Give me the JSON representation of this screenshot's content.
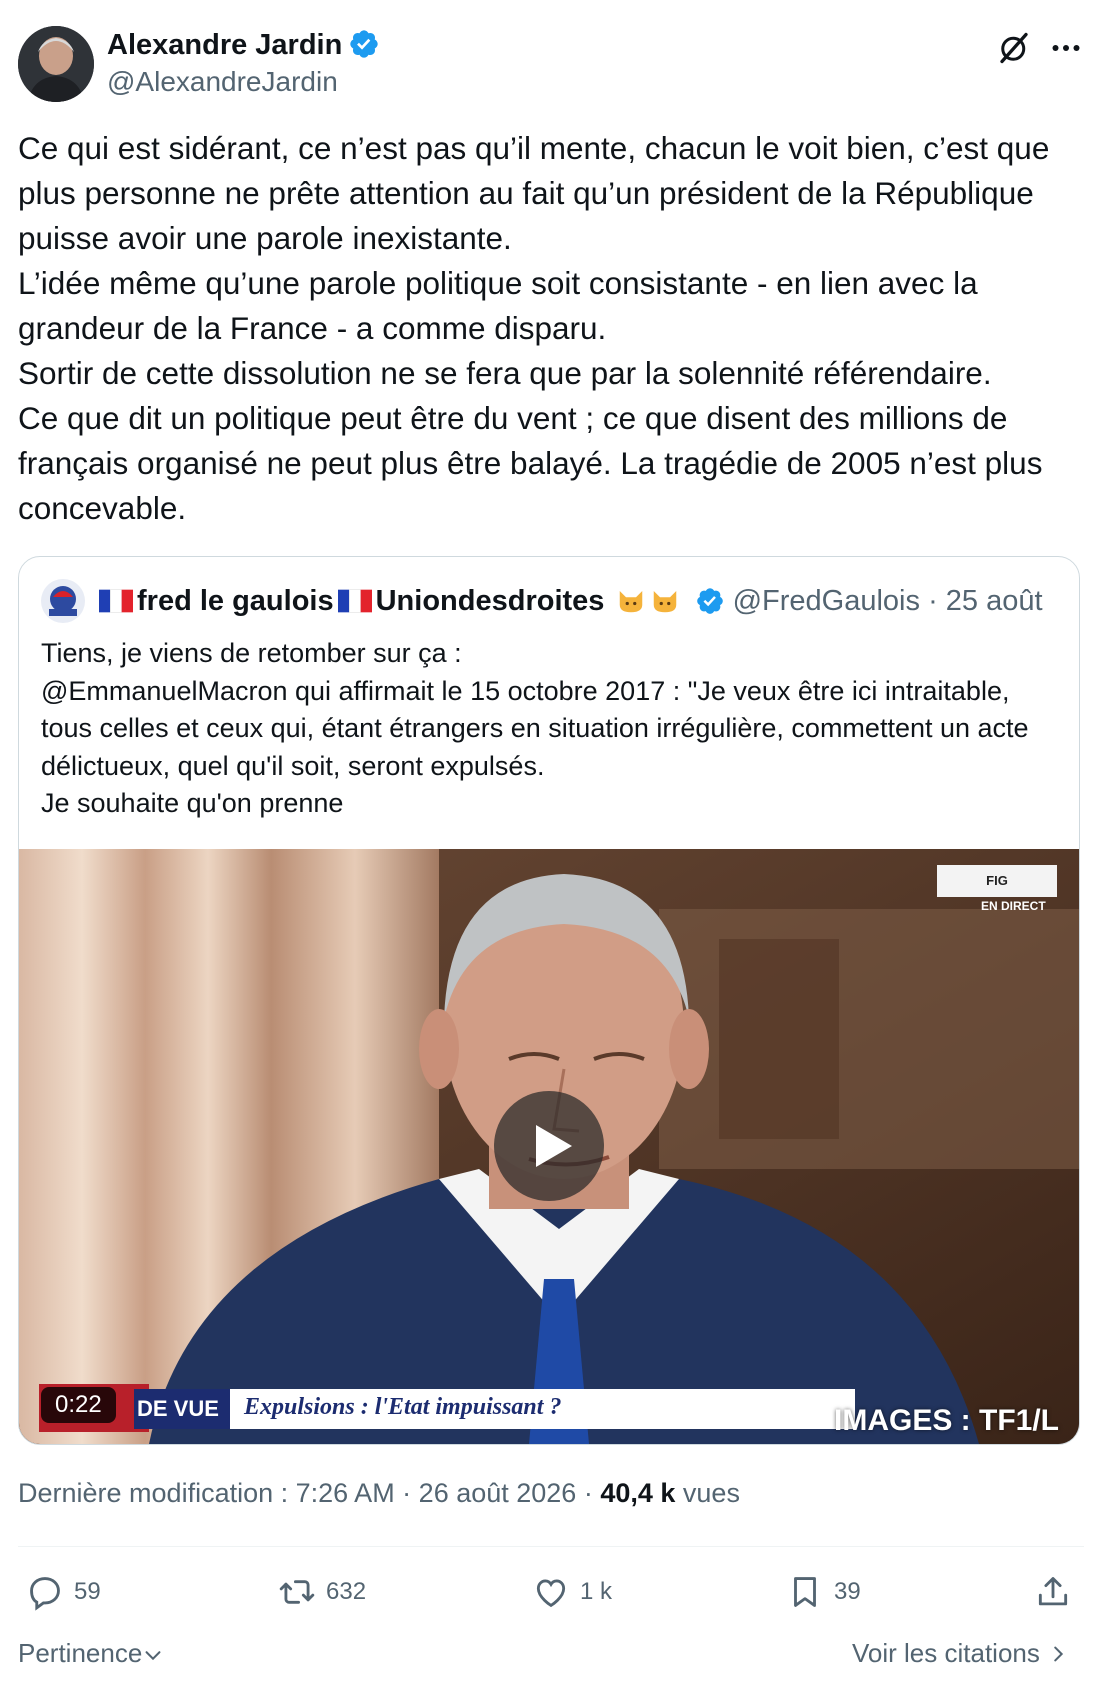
{
  "author": {
    "name": "Alexandre Jardin",
    "handle": "@AlexandreJardin"
  },
  "tweet": {
    "paragraphs": [
      "Ce qui est sidérant, ce n’est pas qu’il mente, chacun le voit bien, c’est que plus personne ne prête attention au fait qu’un président de la République puisse avoir une parole inexistante.",
      "L’idée même qu’une parole politique soit consistante - en lien avec la grandeur de la France - a comme disparu.",
      "Sortir de cette dissolution ne se fera que par la solennité référendaire.",
      "Ce que dit un politique peut être du vent ; ce que disent des millions de français organisé ne peut plus être balayé. La tragédie de 2005 n’est plus concevable."
    ]
  },
  "quote": {
    "name_part1": "fred le gaulois",
    "name_part2": "Uniondesdroites",
    "handle": "@FredGaulois",
    "separator": " · ",
    "date": "25 août",
    "lines": [
      "Tiens, je viens de retomber sur ça :",
      "@EmmanuelMacron qui affirmait le 15 octobre 2017 : \"Je veux être ici intraitable, tous celles et ceux qui, étant étrangers en situation irrégulière, commettent un acte délictueux, quel qu'il soit, seront expulsés.",
      "Je souhaite qu'on prenne"
    ],
    "video": {
      "duration": "0:22",
      "band_label": "DE VUE",
      "band_title": "Expulsions : l'Etat impuissant ?",
      "credit": "IMAGES : TF1/L",
      "channel_logo": "FIG",
      "live": "EN DIRECT"
    }
  },
  "meta": {
    "modified_label": "Dernière modification : 7:26 AM · 26 août 2026 · ",
    "views_count": "40,4 k",
    "views_label": " vues"
  },
  "actions": {
    "replies": "59",
    "reposts": "632",
    "likes": "1 k",
    "bookmarks": "39"
  },
  "footer": {
    "sort_label": "Pertinence",
    "quotes_link": "Voir les citations"
  },
  "colors": {
    "verified": "#1d9bf0",
    "secondary_text": "#536471",
    "primary_text": "#0f1419"
  }
}
